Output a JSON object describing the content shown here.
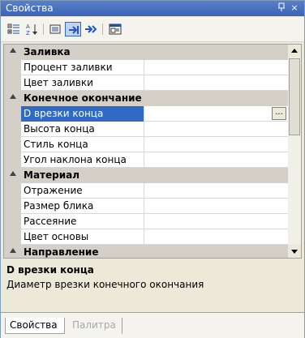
{
  "window": {
    "title": "Свойства"
  },
  "title_buttons": {
    "pin_label": "ᵽ",
    "close_label": "×"
  },
  "toolbar": {
    "tools": [
      {
        "name": "categorized-view",
        "icon": "categorized-icon",
        "active": false
      },
      {
        "name": "alphabetical-sort",
        "icon": "sort-az-icon",
        "active": false
      },
      {
        "name": "properties-view",
        "icon": "properties-icon",
        "active": false
      },
      {
        "name": "property-pages",
        "icon": "arrow-right-active-icon",
        "active": true
      },
      {
        "name": "events",
        "icon": "arrow-right-icon",
        "active": false
      },
      {
        "name": "property-page-window",
        "icon": "window-icon",
        "active": false
      }
    ]
  },
  "grid": {
    "rows": [
      {
        "type": "category",
        "label": "Заливка"
      },
      {
        "type": "property",
        "label": "Процент заливки",
        "value": ""
      },
      {
        "type": "property",
        "label": "Цвет заливки",
        "value": ""
      },
      {
        "type": "category",
        "label": "Конечное окончание"
      },
      {
        "type": "property",
        "label": "D врезки конца",
        "value": "",
        "selected": true,
        "ellipsis": "..."
      },
      {
        "type": "property",
        "label": "Высота конца",
        "value": ""
      },
      {
        "type": "property",
        "label": "Стиль конца",
        "value": ""
      },
      {
        "type": "property",
        "label": "Угол наклона конца",
        "value": ""
      },
      {
        "type": "category",
        "label": "Материал"
      },
      {
        "type": "property",
        "label": "Отражение",
        "value": ""
      },
      {
        "type": "property",
        "label": "Размер блика",
        "value": ""
      },
      {
        "type": "property",
        "label": "Рассеяние",
        "value": ""
      },
      {
        "type": "property",
        "label": "Цвет основы",
        "value": ""
      },
      {
        "type": "category",
        "label": "Направление"
      }
    ]
  },
  "description": {
    "title": "D врезки конца",
    "text": "Диаметр врезки конечного окончания"
  },
  "tabs": [
    {
      "label": "Свойства",
      "active": true
    },
    {
      "label": "Палитра",
      "active": false
    }
  ],
  "colors": {
    "titlebar": "#3a63b8",
    "selection": "#316ac5",
    "category_bg": "#d4d0c8",
    "panel_bg": "#ece9d8"
  }
}
